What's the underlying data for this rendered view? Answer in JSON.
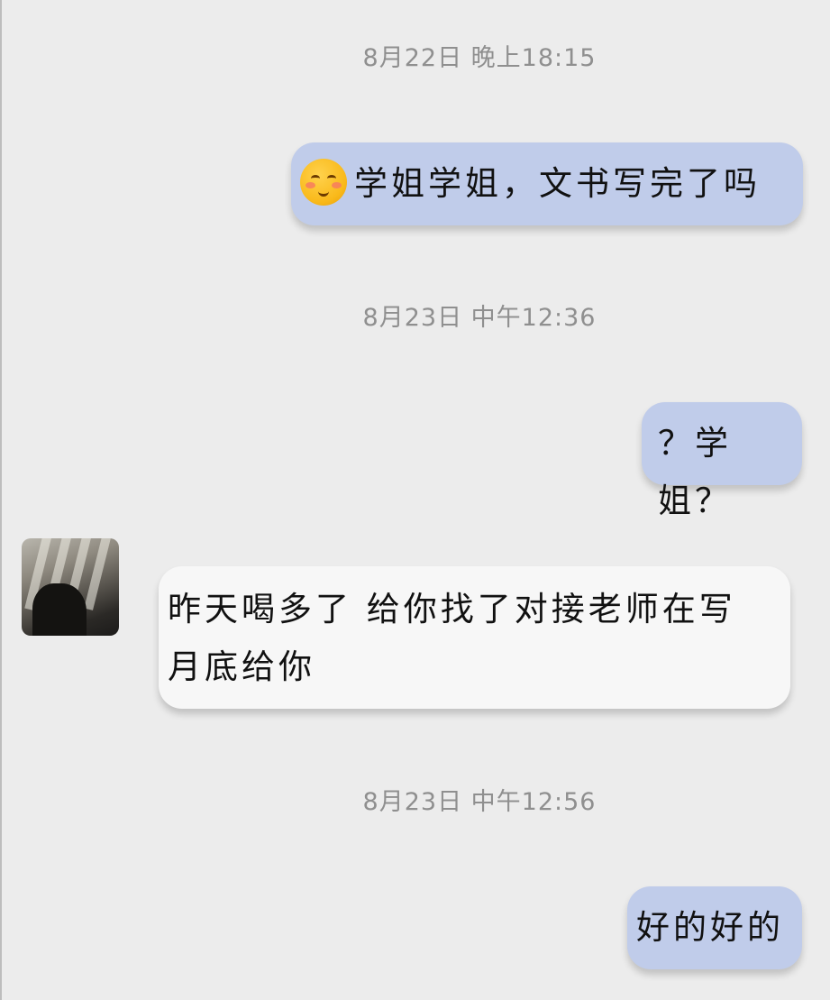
{
  "conversation": {
    "timestamps": [
      "8月22日 晚上18:15",
      "8月23日 中午12:36",
      "8月23日 中午12:56"
    ],
    "messages": [
      {
        "direction": "outgoing",
        "emoji": "blushing-smile-emoji",
        "text": "学姐学姐，文书写完了吗"
      },
      {
        "direction": "outgoing",
        "text": "？学姐？"
      },
      {
        "direction": "incoming",
        "text": "昨天喝多了 给你找了对接老师在写 月底给你"
      },
      {
        "direction": "outgoing",
        "text": "好的好的"
      }
    ]
  },
  "colors": {
    "background": "#ececec",
    "outgoing_bubble": "#c0ccea",
    "incoming_bubble": "#f7f7f7",
    "timestamp_text": "#8f8f8f"
  }
}
